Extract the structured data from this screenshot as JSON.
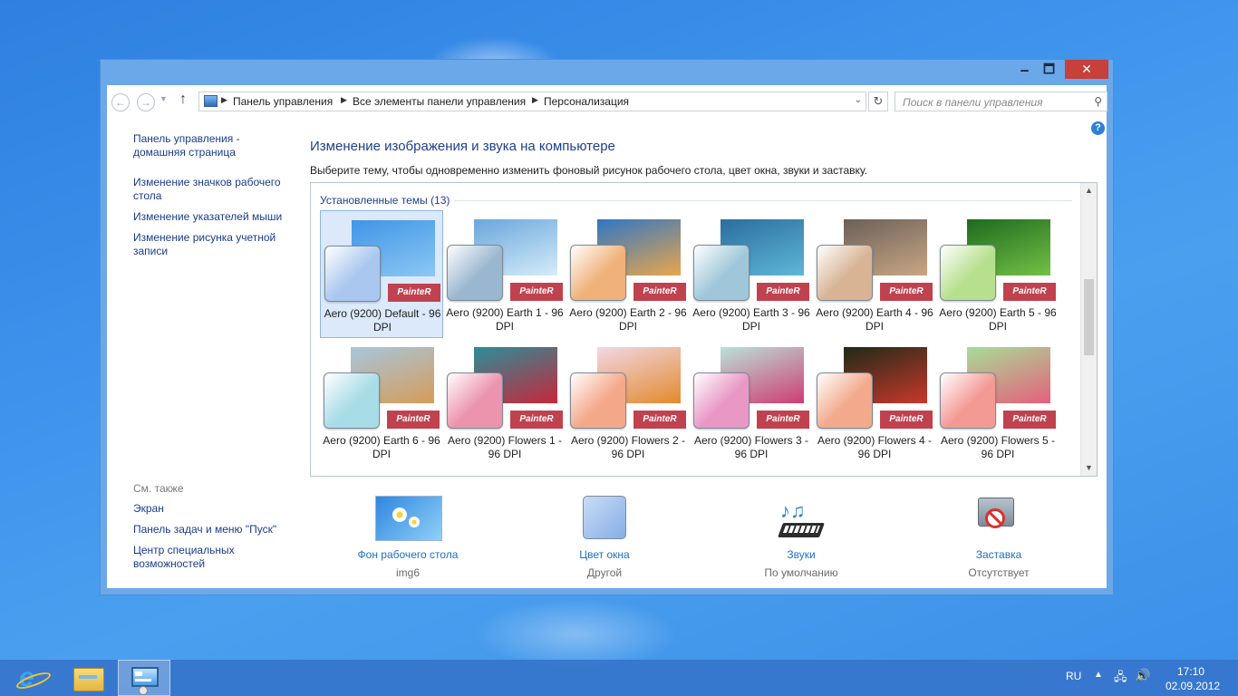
{
  "window": {
    "minimize": "🗕",
    "maximize": "🗖",
    "close": "✕"
  },
  "nav": {
    "back": "←",
    "forward": "→",
    "up": "↑",
    "breadcrumb": [
      "Панель управления",
      "Все элементы панели управления",
      "Персонализация"
    ],
    "search_placeholder": "Поиск в панели управления",
    "help": "?"
  },
  "sidebar": {
    "links": [
      "Панель управления - домашняя страница",
      "Изменение значков рабочего стола",
      "Изменение указателей мыши",
      "Изменение рисунка учетной записи"
    ],
    "see_also_title": "См. также",
    "see_also": [
      "Экран",
      "Панель задач и меню \"Пуск\"",
      "Центр специальных возможностей"
    ]
  },
  "main": {
    "title": "Изменение изображения и звука на компьютере",
    "description": "Выберите тему, чтобы одновременно изменить фоновый рисунок рабочего стола, цвет окна, звуки и заставку.",
    "group_title": "Установленные темы (13)"
  },
  "themes": [
    {
      "label": "Aero (9200) Default - 96 DPI",
      "brand": "PainteR",
      "selected": true,
      "swatch": "#a9c7ef",
      "thumb": [
        "#3f95e6",
        "#8cc8f4"
      ]
    },
    {
      "label": "Aero (9200) Earth 1 - 96 DPI",
      "brand": "PainteR",
      "selected": false,
      "swatch": "#9bb7cf",
      "thumb": [
        "#6aa6dc",
        "#d4ecf8"
      ]
    },
    {
      "label": "Aero (9200) Earth 2 - 96 DPI",
      "brand": "PainteR",
      "selected": false,
      "swatch": "#f0b27a",
      "thumb": [
        "#2f76c5",
        "#e9a64b"
      ]
    },
    {
      "label": "Aero (9200) Earth 3 - 96 DPI",
      "brand": "PainteR",
      "selected": false,
      "swatch": "#9fc7d9",
      "thumb": [
        "#2a6e9e",
        "#5fb6d8"
      ]
    },
    {
      "label": "Aero (9200) Earth 4 - 96 DPI",
      "brand": "PainteR",
      "selected": false,
      "swatch": "#d8b394",
      "thumb": [
        "#6b6058",
        "#c9a684"
      ]
    },
    {
      "label": "Aero (9200) Earth 5 - 96 DPI",
      "brand": "PainteR",
      "selected": false,
      "swatch": "#b6e08e",
      "thumb": [
        "#1d6a1f",
        "#74c046"
      ]
    },
    {
      "label": "Aero (9200) Earth 6 - 96 DPI",
      "brand": "PainteR",
      "selected": false,
      "swatch": "#a8dce6",
      "thumb": [
        "#a6c6dd",
        "#d69c58"
      ]
    },
    {
      "label": "Aero (9200) Flowers 1 - 96 DPI",
      "brand": "PainteR",
      "selected": false,
      "swatch": "#ec93ad",
      "thumb": [
        "#2a8e99",
        "#c8273a"
      ]
    },
    {
      "label": "Aero (9200) Flowers 2 - 96 DPI",
      "brand": "PainteR",
      "selected": false,
      "swatch": "#f4a88a",
      "thumb": [
        "#f1d7e5",
        "#e38a2c"
      ]
    },
    {
      "label": "Aero (9200) Flowers 3 - 96 DPI",
      "brand": "PainteR",
      "selected": false,
      "swatch": "#e997c5",
      "thumb": [
        "#b9e2d7",
        "#cf3d74"
      ]
    },
    {
      "label": "Aero (9200) Flowers 4 - 96 DPI",
      "brand": "PainteR",
      "selected": false,
      "swatch": "#f2a98c",
      "thumb": [
        "#1e2a17",
        "#c9382c"
      ]
    },
    {
      "label": "Aero (9200) Flowers 5 - 96 DPI",
      "brand": "PainteR",
      "selected": false,
      "swatch": "#f39a95",
      "thumb": [
        "#a7dd98",
        "#e5607c"
      ]
    }
  ],
  "options": [
    {
      "link": "Фон рабочего стола",
      "sub": "img6",
      "icon": "desktop-background-icon"
    },
    {
      "link": "Цвет окна",
      "sub": "Другой",
      "icon": "window-color-icon"
    },
    {
      "link": "Звуки",
      "sub": "По умолчанию",
      "icon": "sounds-icon"
    },
    {
      "link": "Заставка",
      "sub": "Отсутствует",
      "icon": "screensaver-icon"
    }
  ],
  "taskbar": {
    "language": "RU",
    "time": "17:10",
    "date": "02.09.2012"
  },
  "colors": {
    "link": "#1a3c8c",
    "title": "#1e3f8f",
    "close_button": "#c7403a",
    "taskbar": "#3675cc"
  }
}
